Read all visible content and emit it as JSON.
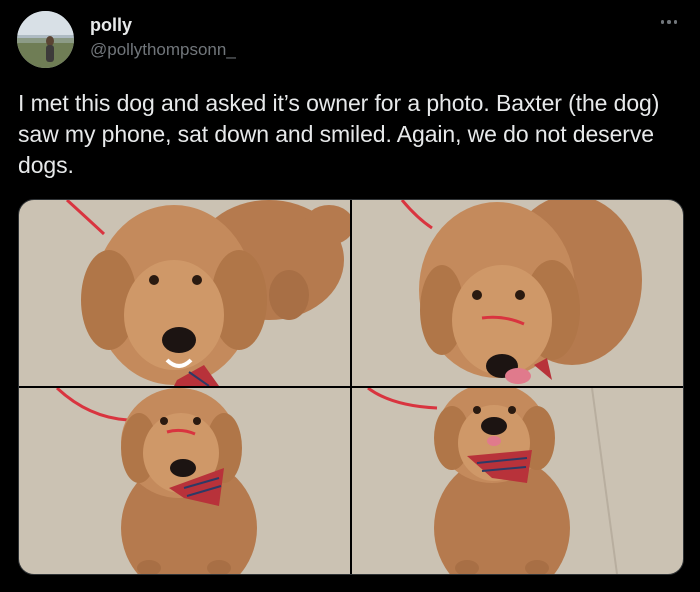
{
  "user": {
    "display_name": "polly",
    "handle": "@pollythompsonn_"
  },
  "tweet": {
    "text": "I met this dog and asked it’s owner for a photo. Baxter (the dog) saw my phone, sat down and smiled. Again, we do not deserve dogs."
  },
  "icons": {
    "more": "more-horizontal-icon"
  },
  "colors": {
    "background": "#000000",
    "text": "#e7e9ea",
    "secondary_text": "#71767b",
    "dog_fur": "#c48a5c",
    "bandana": "#b8323a",
    "leash": "#d9343f"
  },
  "media": {
    "photo_count": 4
  }
}
